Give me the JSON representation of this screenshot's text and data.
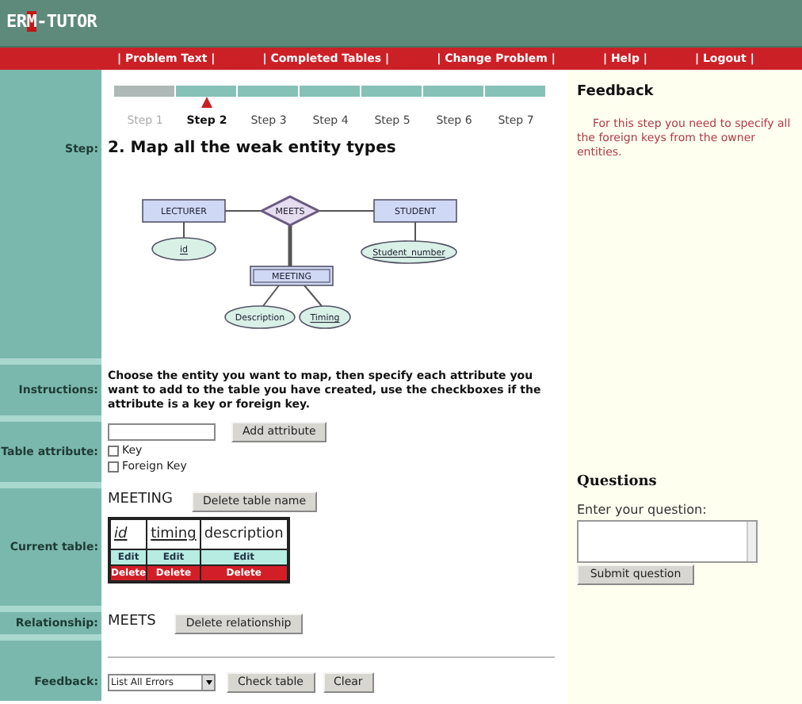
{
  "logo": {
    "prefix": "ER",
    "highlight": "M",
    "suffix": "-TUTOR"
  },
  "nav": [
    "| Problem Text |",
    "| Completed Tables |",
    "| Change Problem |",
    "| Help |",
    "| Logout |"
  ],
  "steps": [
    {
      "label": "Step 1",
      "selected": false,
      "completed": true
    },
    {
      "label": "Step 2",
      "selected": true,
      "completed": false
    },
    {
      "label": "Step 3",
      "selected": false,
      "completed": false
    },
    {
      "label": "Step 4",
      "selected": false,
      "completed": false
    },
    {
      "label": "Step 5",
      "selected": false,
      "completed": false
    },
    {
      "label": "Step 6",
      "selected": false,
      "completed": false
    },
    {
      "label": "Step 7",
      "selected": false,
      "completed": false
    }
  ],
  "step": {
    "label": "Step:",
    "title": "2. Map all the weak entity types"
  },
  "diagram": [
    {
      "kind": "entity",
      "text": "LECTURER"
    },
    {
      "kind": "relationship",
      "text": "MEETS"
    },
    {
      "kind": "entity",
      "text": "STUDENT"
    },
    {
      "kind": "attribute",
      "text": "id",
      "key": true
    },
    {
      "kind": "attribute",
      "text": "Student_number",
      "key": true
    },
    {
      "kind": "weak_entity",
      "text": "MEETING"
    },
    {
      "kind": "attribute",
      "text": "Description",
      "key": false
    },
    {
      "kind": "attribute",
      "text": "Timing",
      "key": true
    }
  ],
  "instructions": {
    "label": "Instructions:",
    "text": "Choose the entity you want to map, then specify each attribute you want to add to the table you have created, use the checkboxes if the attribute is a key or foreign key."
  },
  "table_attribute": {
    "label": "Table attribute:",
    "button": "Add attribute",
    "checkboxes": [
      {
        "label": "Key",
        "checked": false
      },
      {
        "label": "Foreign Key",
        "checked": false
      }
    ]
  },
  "current_table": {
    "label": "Current table:",
    "name": "MEETING",
    "button": "Delete table name",
    "columns": [
      {
        "name": "id",
        "key": true,
        "foreign_key": true,
        "edit": "Edit",
        "delete": "Delete"
      },
      {
        "name": "timing",
        "key": true,
        "foreign_key": false,
        "edit": "Edit",
        "delete": "Delete"
      },
      {
        "name": "description",
        "key": false,
        "foreign_key": false,
        "edit": "Edit",
        "delete": "Delete"
      }
    ]
  },
  "relationship": {
    "label": "Relationship:",
    "name": "MEETS",
    "button": "Delete relationship"
  },
  "feedback_row": {
    "label": "Feedback:",
    "select": "List All Errors",
    "buttons": [
      "Check table",
      "Clear"
    ]
  },
  "feedback_panel": {
    "title": "Feedback",
    "text": "For this step you need to specify all the foreign keys from the owner entities."
  },
  "questions": {
    "title": "Questions",
    "prompt": "Enter your question:",
    "button": "Submit question"
  }
}
